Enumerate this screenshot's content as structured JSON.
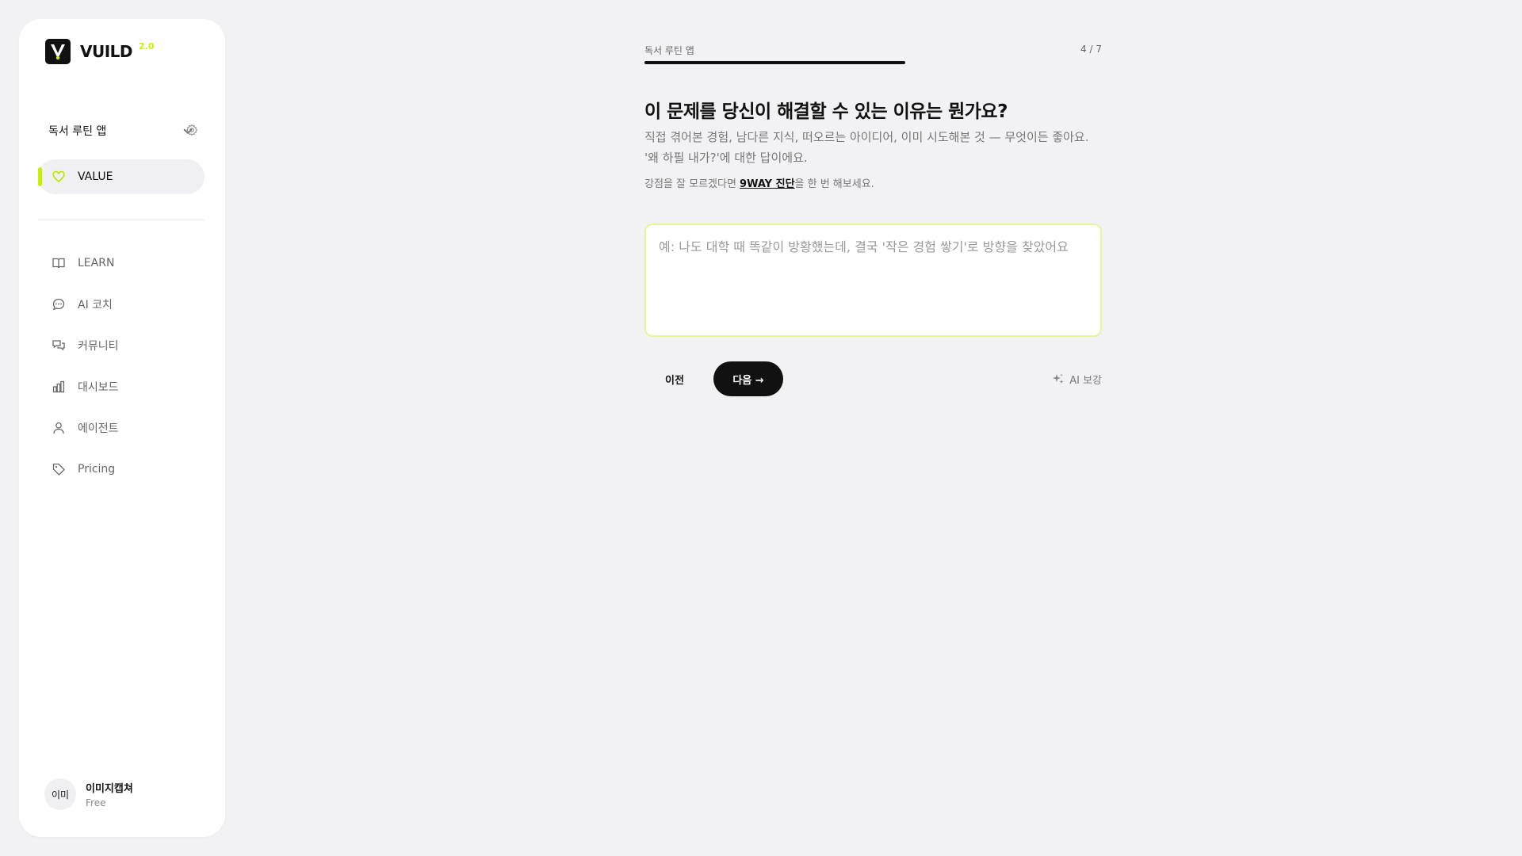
{
  "brand": {
    "name": "VUILD",
    "version": "2.0"
  },
  "project": {
    "name": "독서 루틴 앱"
  },
  "nav": {
    "active": {
      "label": "VALUE",
      "icon": "heart-icon"
    },
    "items": [
      {
        "label": "LEARN",
        "icon": "book-icon"
      },
      {
        "label": "AI 코치",
        "icon": "chat-icon"
      },
      {
        "label": "커뮤니티",
        "icon": "community-icon"
      },
      {
        "label": "대시보드",
        "icon": "bar-chart-icon"
      },
      {
        "label": "에이전트",
        "icon": "user-icon"
      },
      {
        "label": "Pricing",
        "icon": "tag-icon"
      }
    ]
  },
  "user": {
    "avatar_text": "이미",
    "name": "이미지캡쳐",
    "plan": "Free"
  },
  "main": {
    "breadcrumb": "독서 루틴 앱",
    "step": "4 / 7",
    "progress": 0.57,
    "question": "이 문제를 당신이 해결할 수 있는 이유는 뭔가요?",
    "description": "직접 겪어본 경험, 남다른 지식, 떠오르는 아이디어, 이미 시도해본 것 — 무엇이든 좋아요. '왜 하필 내가?'에 대한 답이에요.",
    "hint_prefix": "강점을 잘 모르겠다면 ",
    "hint_link": "9WAY 진단",
    "hint_suffix": "을 한 번 해보세요.",
    "answer_placeholder": "예: 나도 대학 때 똑같이 방황했는데, 결국 '작은 경험 쌓기'로 방향을 찾았어요",
    "answer_value": "",
    "prev_label": "이전",
    "next_label": "다음 →",
    "ai_label": "AI 보강"
  },
  "colors": {
    "accent": "#c6f000",
    "primary": "#111111",
    "background": "#f2f2f4"
  }
}
